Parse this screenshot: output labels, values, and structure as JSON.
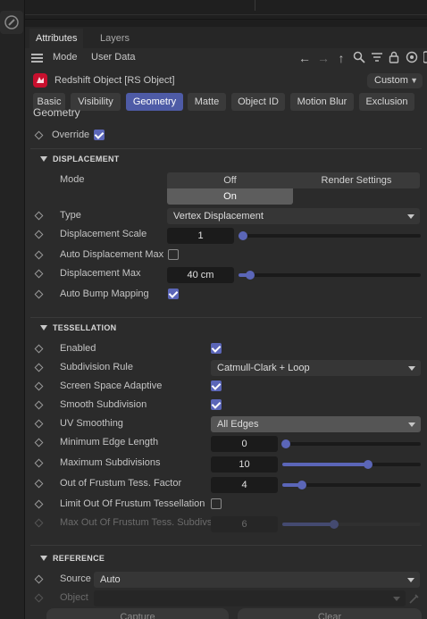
{
  "tabs": {
    "attributes": "Attributes",
    "layers": "Layers"
  },
  "menu": {
    "mode": "Mode",
    "user_data": "User Data"
  },
  "object": {
    "title": "Redshift Object [RS Object]",
    "preset": "Custom"
  },
  "category_tabs": [
    "Basic",
    "Visibility",
    "Geometry",
    "Matte",
    "Object ID",
    "Motion Blur",
    "Exclusion"
  ],
  "geometry": {
    "title": "Geometry",
    "override_label": "Override",
    "override_checked": true
  },
  "displacement": {
    "header": "DISPLACEMENT",
    "mode_label": "Mode",
    "mode_options": [
      "Off",
      "Render Settings",
      "On"
    ],
    "mode_selected": "On",
    "type_label": "Type",
    "type_value": "Vertex Displacement",
    "scale_label": "Displacement Scale",
    "scale_value": "1",
    "auto_max_label": "Auto Displacement Max",
    "auto_max_checked": false,
    "max_label": "Displacement Max",
    "max_value": "40 cm",
    "auto_bump_label": "Auto Bump Mapping",
    "auto_bump_checked": true
  },
  "tessellation": {
    "header": "TESSELLATION",
    "enabled_label": "Enabled",
    "subdivision_rule_label": "Subdivision Rule",
    "subdivision_rule_value": "Catmull-Clark + Loop",
    "screen_space_label": "Screen Space Adaptive",
    "smooth_sub_label": "Smooth Subdivision",
    "uv_smoothing_label": "UV Smoothing",
    "uv_smoothing_value": "All Edges",
    "min_edge_label": "Minimum Edge Length",
    "min_edge_value": "0",
    "max_sub_label": "Maximum Subdivisions",
    "max_sub_value": "10",
    "frustum_label": "Out of Frustum Tess. Factor",
    "frustum_value": "4",
    "limit_frustum_label": "Limit Out Of Frustum Tessellation",
    "max_frustum_label": "Max Out Of Frustum Tess. Subdivs",
    "max_frustum_value": "6"
  },
  "reference": {
    "header": "REFERENCE",
    "source_label": "Source",
    "source_value": "Auto",
    "object_label": "Object",
    "capture_label": "Capture",
    "clear_label": "Clear"
  },
  "colors": {
    "accent": "#5b66b8",
    "panel": "#2b2b2b",
    "brand": "#c8102e"
  },
  "icons": [
    "arrow-left-icon",
    "arrow-right-icon",
    "arrow-up-icon",
    "search-icon",
    "filter-icon",
    "lock-icon",
    "target-icon",
    "more-icon",
    "eyedropper-icon"
  ]
}
